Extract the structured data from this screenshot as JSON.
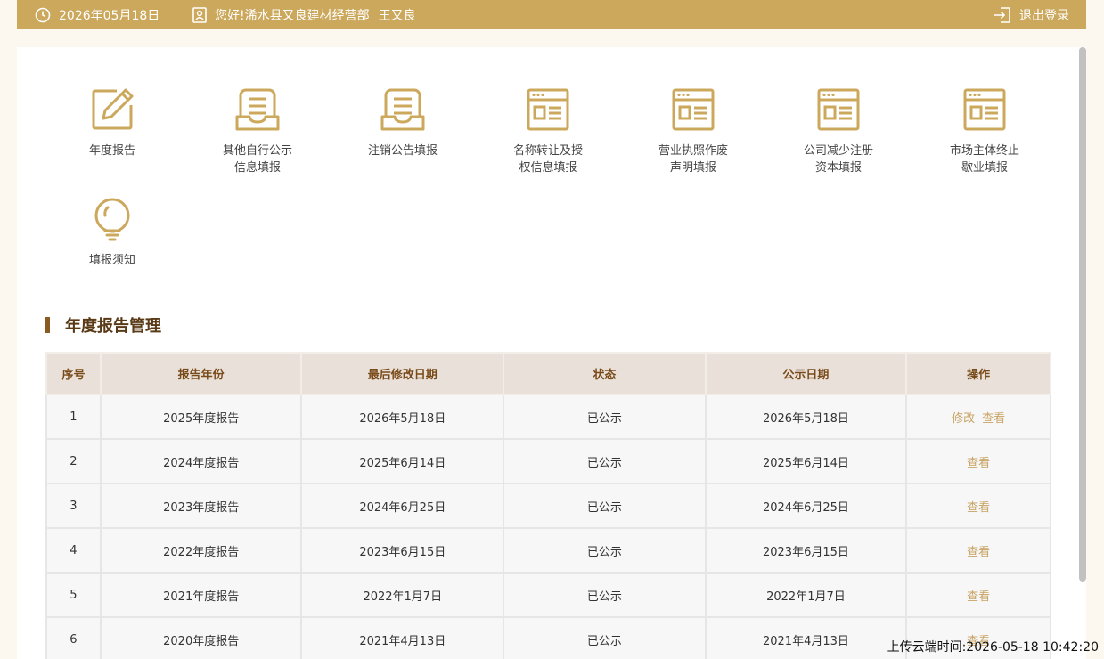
{
  "topbar": {
    "date": "2026年05月18日",
    "greeting": "您好!浠水县又良建材经营部",
    "username": "王又良",
    "logout_label": "退出登录",
    "icons": {
      "date": "clock-icon",
      "user": "user-badge-icon",
      "logout": "logout-icon"
    }
  },
  "quick_links": [
    {
      "lines": [
        "年度报告"
      ],
      "icon": "edit-icon"
    },
    {
      "lines": [
        "其他自行公示",
        "信息填报"
      ],
      "icon": "inbox-icon"
    },
    {
      "lines": [
        "注销公告填报"
      ],
      "icon": "inbox-icon"
    },
    {
      "lines": [
        "名称转让及授",
        "权信息填报"
      ],
      "icon": "window-form-icon"
    },
    {
      "lines": [
        "营业执照作废",
        "声明填报"
      ],
      "icon": "window-form-icon"
    },
    {
      "lines": [
        "公司减少注册",
        "资本填报"
      ],
      "icon": "window-form-icon"
    },
    {
      "lines": [
        "市场主体终止",
        "歇业填报"
      ],
      "icon": "window-form-icon"
    },
    {
      "lines": [
        "填报须知"
      ],
      "icon": "lightbulb-icon"
    }
  ],
  "section": {
    "title": "年度报告管理"
  },
  "table": {
    "headers": [
      "序号",
      "报告年份",
      "最后修改日期",
      "状态",
      "公示日期",
      "操作"
    ],
    "rows": [
      {
        "no": "1",
        "year": "2025年度报告",
        "modified": "2026年5月18日",
        "status": "已公示",
        "published": "2026年5月18日",
        "edit": "修改",
        "view": "查看"
      },
      {
        "no": "2",
        "year": "2024年度报告",
        "modified": "2025年6月14日",
        "status": "已公示",
        "published": "2025年6月14日",
        "edit": "",
        "view": "查看"
      },
      {
        "no": "3",
        "year": "2023年度报告",
        "modified": "2024年6月25日",
        "status": "已公示",
        "published": "2024年6月25日",
        "edit": "",
        "view": "查看"
      },
      {
        "no": "4",
        "year": "2022年度报告",
        "modified": "2023年6月15日",
        "status": "已公示",
        "published": "2023年6月15日",
        "edit": "",
        "view": "查看"
      },
      {
        "no": "5",
        "year": "2021年度报告",
        "modified": "2022年1月7日",
        "status": "已公示",
        "published": "2022年1月7日",
        "edit": "",
        "view": "查看"
      },
      {
        "no": "6",
        "year": "2020年度报告",
        "modified": "2021年4月13日",
        "status": "已公示",
        "published": "2021年4月13日",
        "edit": "",
        "view": "查看"
      }
    ]
  },
  "footer": {
    "upload_time": "上传云端时间:2026-05-18 10:42:20"
  },
  "colors": {
    "accent": "#cca85c",
    "title": "#5a3a16",
    "link": "#c8a464"
  }
}
